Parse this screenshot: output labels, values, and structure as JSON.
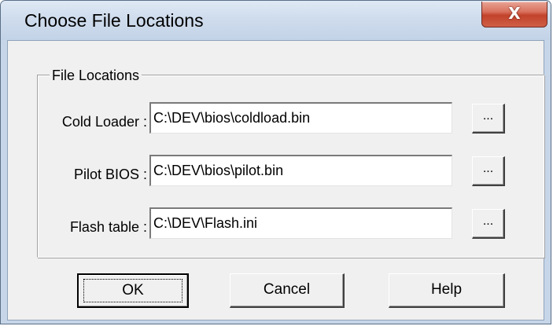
{
  "window": {
    "title": "Choose File Locations",
    "close_glyph": "X"
  },
  "group": {
    "label": "File Locations"
  },
  "fields": [
    {
      "label": "Cold Loader :",
      "value": "C:\\DEV\\bios\\coldload.bin",
      "browse_label": "..."
    },
    {
      "label": "Pilot BIOS :",
      "value": "C:\\DEV\\bios\\pilot.bin",
      "browse_label": "..."
    },
    {
      "label": "Flash table :",
      "value": "C:\\DEV\\Flash.ini",
      "browse_label": "..."
    }
  ],
  "buttons": {
    "ok": "OK",
    "cancel": "Cancel",
    "help": "Help"
  },
  "icons": {
    "close": "close-icon"
  },
  "colors": {
    "close_button": "#c8482f",
    "titlebar": "#cfdced",
    "dialog_face": "#f0f0f0"
  }
}
